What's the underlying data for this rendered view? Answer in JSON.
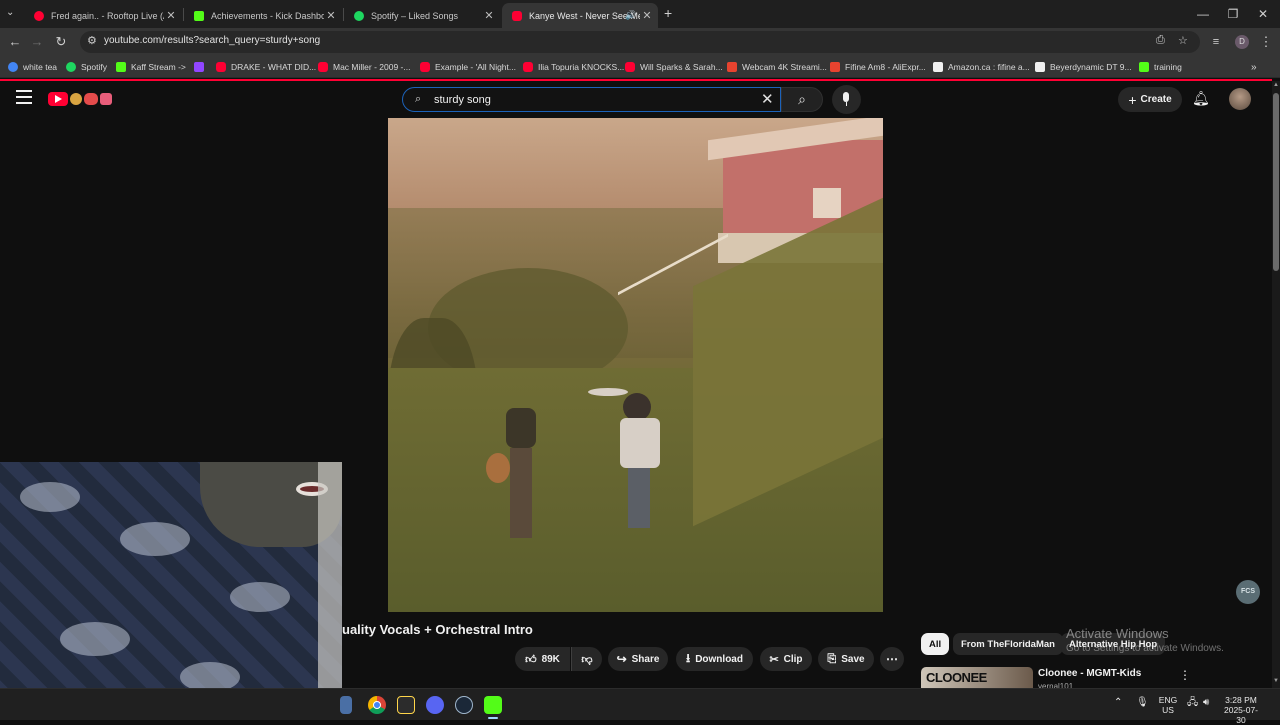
{
  "browser": {
    "tabs": [
      {
        "title": "Fred again.. - Rooftop Live (An",
        "favicon_color": "#ff0033",
        "active": false
      },
      {
        "title": "Achievements - Kick Dashboard",
        "favicon_color": "#53fc18",
        "active": false
      },
      {
        "title": "Spotify – Liked Songs",
        "favicon_color": "#1ed760",
        "active": false
      },
      {
        "title": "Kanye West - Never See Me",
        "favicon_color": "#ff0033",
        "active": true
      }
    ],
    "new_tab": "+",
    "url": "youtube.com/results?search_query=sturdy+song",
    "bookmarks": [
      {
        "label": "white tea",
        "color": "#4285f4"
      },
      {
        "label": "Spotify",
        "color": "#1ed760"
      },
      {
        "label": "Kaff Stream ->",
        "color": "#53fc18"
      },
      {
        "label": "",
        "color": "#9146ff"
      },
      {
        "label": "DRAKE - WHAT DID...",
        "color": "#ff0033"
      },
      {
        "label": "Mac Miller - 2009 -...",
        "color": "#ff0033"
      },
      {
        "label": "Example - 'All Night...",
        "color": "#ff0033"
      },
      {
        "label": "Ilia Topuria KNOCKS...",
        "color": "#ff0033"
      },
      {
        "label": "Will Sparks & Sarah...",
        "color": "#ff0033"
      },
      {
        "label": "Webcam 4K Streami...",
        "color": "#e8432f"
      },
      {
        "label": "Fifine Am8 - AliExpr...",
        "color": "#e8432f"
      },
      {
        "label": "Amazon.ca : fifine a...",
        "color": "#f0f0f0"
      },
      {
        "label": "Beyerdynamic DT 9...",
        "color": "#f0f0f0"
      },
      {
        "label": "training",
        "color": "#53fc18"
      }
    ]
  },
  "youtube": {
    "search_value": "sturdy song",
    "create_label": "Create",
    "video_title": "uality Vocals + Orchestral Intro",
    "actions": {
      "like_count": "89K",
      "share": "Share",
      "download": "Download",
      "clip": "Clip",
      "save": "Save"
    },
    "chips": [
      "All",
      "From TheFloridaMan",
      "Alternative Hip Hop"
    ],
    "recommended": [
      {
        "title": "Cloonee - MGMT-Kids",
        "thumb_text": "CLOONEE",
        "channel": "vernal101"
      }
    ],
    "corner_badge": "FCS"
  },
  "watermark": {
    "line1": "Activate Windows",
    "line2": "Go to Settings to activate Windows."
  },
  "taskbar": {
    "lang": "ENG",
    "region": "US",
    "time": "3:28 PM",
    "date": "2025-07-30"
  }
}
